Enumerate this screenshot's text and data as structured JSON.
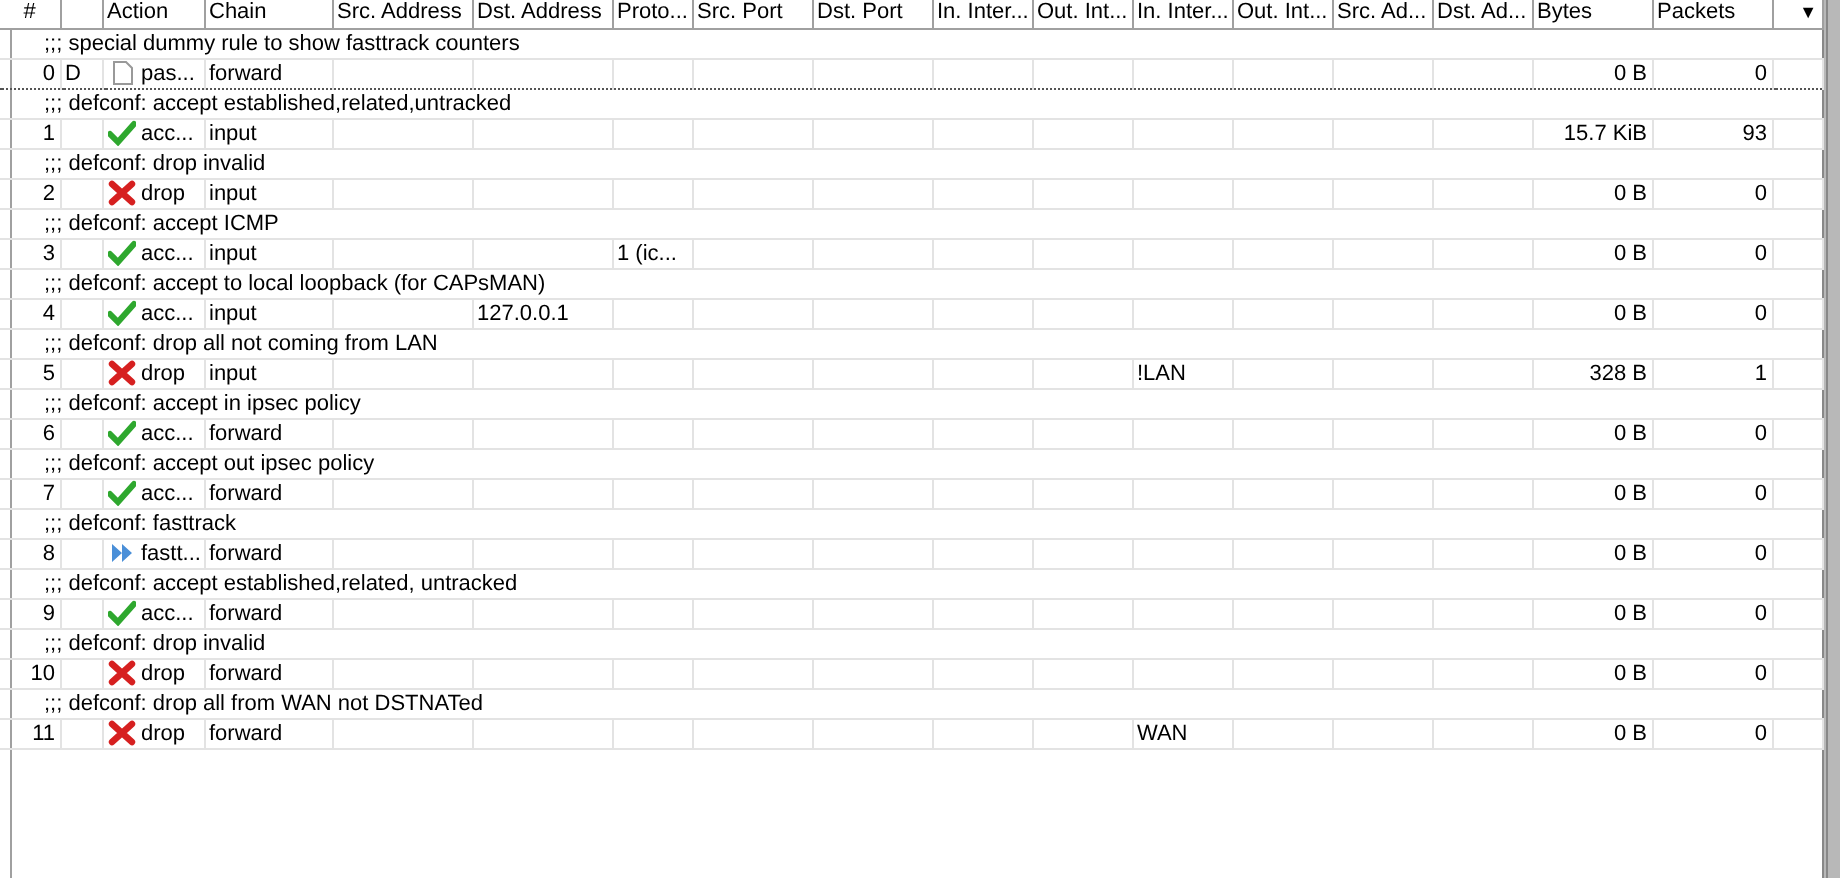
{
  "table": {
    "columns": [
      {
        "label": "#"
      },
      {},
      {
        "label": "Action"
      },
      {
        "label": "Chain"
      },
      {
        "label": "Src. Address"
      },
      {
        "label": "Dst. Address"
      },
      {
        "label": "Proto..."
      },
      {
        "label": "Src. Port"
      },
      {
        "label": "Dst. Port"
      },
      {
        "label": "In. Inter..."
      },
      {
        "label": "Out. Int..."
      },
      {
        "label": "In. Inter..."
      },
      {
        "label": "Out. Int..."
      },
      {
        "label": "Src. Ad..."
      },
      {
        "label": "Dst. Ad..."
      },
      {
        "label": "Bytes"
      },
      {
        "label": "Packets"
      }
    ],
    "menu_arrow": "▼",
    "rules": [
      {
        "comment": ";;; special dummy rule to show fasttrack counters",
        "number": "0",
        "flag": "D",
        "kind": "passthrough",
        "action": "pas...",
        "chain": "forward",
        "bytes": "0 B",
        "packets": "0",
        "focused": true
      },
      {
        "comment": ";;; defconf: accept established,related,untracked",
        "number": "1",
        "kind": "accept",
        "action": "acc...",
        "chain": "input",
        "bytes": "15.7 KiB",
        "packets": "93",
        "focused": false
      },
      {
        "comment": ";;; defconf: drop invalid",
        "number": "2",
        "kind": "drop",
        "action": "drop",
        "chain": "input",
        "bytes": "0 B",
        "packets": "0",
        "focused": false
      },
      {
        "comment": ";;; defconf: accept ICMP",
        "number": "3",
        "kind": "accept",
        "action": "acc...",
        "chain": "input",
        "protocol": "1 (ic...",
        "bytes": "0 B",
        "packets": "0",
        "focused": false
      },
      {
        "comment": ";;; defconf: accept to local loopback (for CAPsMAN)",
        "number": "4",
        "kind": "accept",
        "action": "acc...",
        "chain": "input",
        "dst_address": "127.0.0.1",
        "bytes": "0 B",
        "packets": "0",
        "focused": false
      },
      {
        "comment": ";;; defconf: drop all not coming from LAN",
        "number": "5",
        "kind": "drop",
        "action": "drop",
        "chain": "input",
        "column_12": "!LAN",
        "bytes": "328 B",
        "packets": "1",
        "focused": false
      },
      {
        "comment": ";;; defconf: accept in ipsec policy",
        "number": "6",
        "kind": "accept",
        "action": "acc...",
        "chain": "forward",
        "bytes": "0 B",
        "packets": "0",
        "focused": false
      },
      {
        "comment": ";;; defconf: accept out ipsec policy",
        "number": "7",
        "kind": "accept",
        "action": "acc...",
        "chain": "forward",
        "bytes": "0 B",
        "packets": "0",
        "focused": false
      },
      {
        "comment": ";;; defconf: fasttrack",
        "number": "8",
        "kind": "fasttrack",
        "action": "fastt...",
        "chain": "forward",
        "bytes": "0 B",
        "packets": "0",
        "focused": false
      },
      {
        "comment": ";;; defconf: accept established,related, untracked",
        "number": "9",
        "kind": "accept",
        "action": "acc...",
        "chain": "forward",
        "bytes": "0 B",
        "packets": "0",
        "focused": false
      },
      {
        "comment": ";;; defconf: drop invalid",
        "number": "10",
        "kind": "drop",
        "action": "drop",
        "chain": "forward",
        "bytes": "0 B",
        "packets": "0",
        "focused": false
      },
      {
        "comment": ";;; defconf: drop all from WAN not DSTNATed",
        "number": "11",
        "kind": "drop",
        "action": "drop",
        "chain": "forward",
        "column_12": "WAN",
        "bytes": "0 B",
        "packets": "0",
        "focused": false
      }
    ]
  }
}
